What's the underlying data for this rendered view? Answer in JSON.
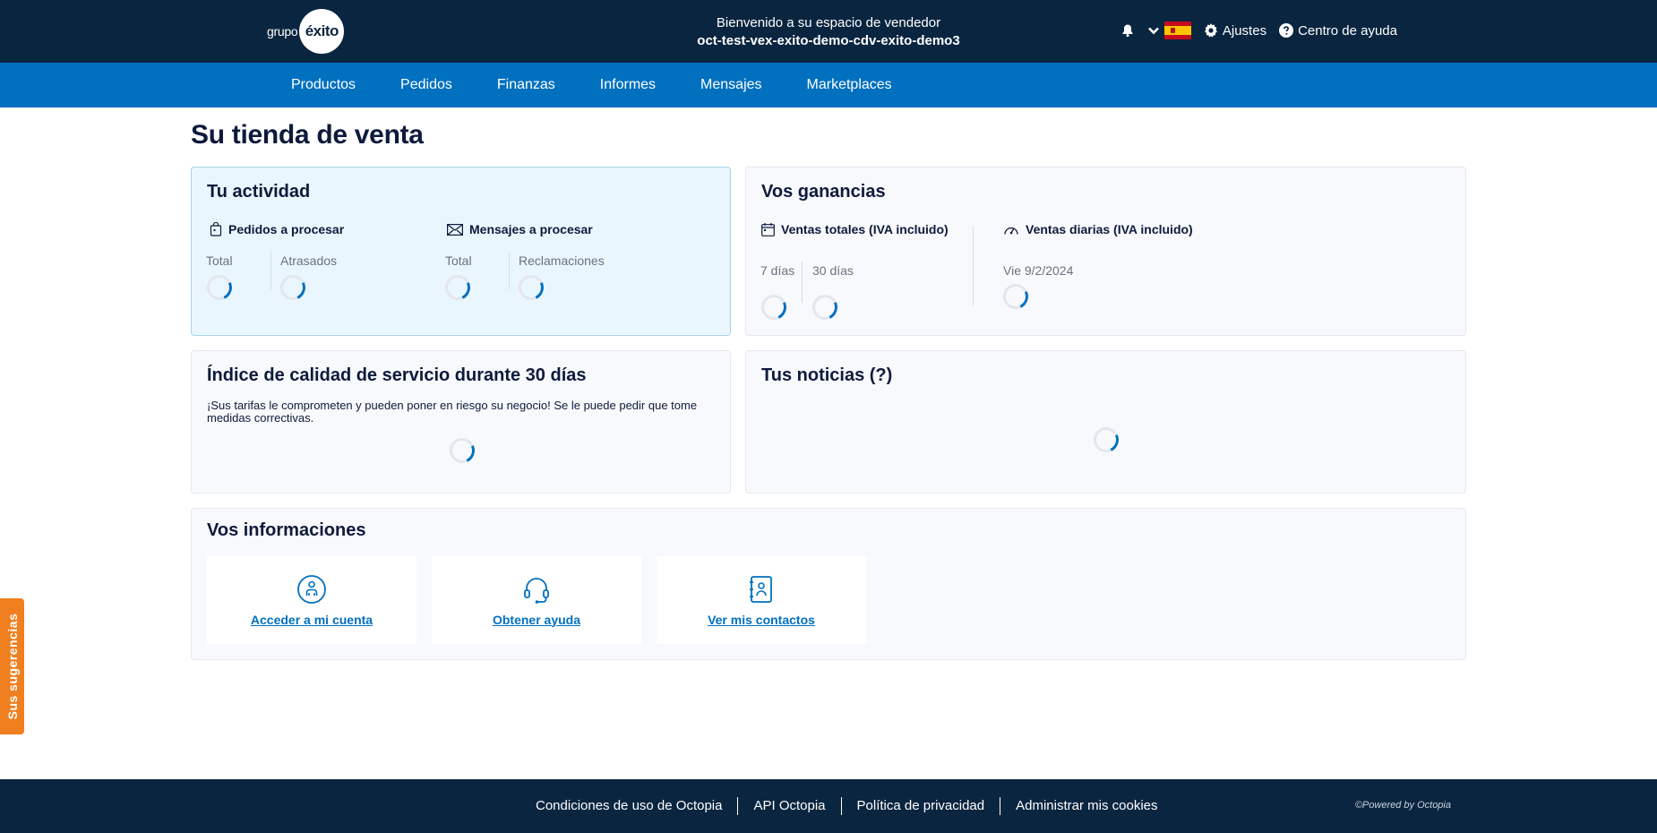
{
  "header": {
    "logo_prefix": "grupo",
    "logo_name": "éxito",
    "welcome": "Bienvenido a su espacio de vendedor",
    "store_id": "oct-test-vex-exito-demo-cdv-exito-demo3",
    "settings_label": "Ajustes",
    "help_label": "Centro de ayuda"
  },
  "nav": {
    "items": [
      "Productos",
      "Pedidos",
      "Finanzas",
      "Informes",
      "Mensajes",
      "Marketplaces"
    ]
  },
  "page": {
    "title": "Su tienda de venta"
  },
  "activity": {
    "title": "Tu actividad",
    "orders_label": "Pedidos a procesar",
    "messages_label": "Mensajes a procesar",
    "orders_total": "Total",
    "orders_late": "Atrasados",
    "messages_total": "Total",
    "messages_claims": "Reclamaciones"
  },
  "earnings": {
    "title": "Vos ganancias",
    "total_sales_label": "Ventas totales (IVA incluido)",
    "daily_sales_label": "Ventas diarias (IVA incluido)",
    "period_7": "7 días",
    "period_30": "30 días",
    "daily_date": "Vie 9/2/2024"
  },
  "quality": {
    "title": "Índice de calidad de servicio durante 30 días",
    "text": "¡Sus tarifas le comprometen y pueden poner en riesgo su negocio! Se le puede pedir que tome medidas correctivas."
  },
  "news": {
    "title": "Tus noticias (?)"
  },
  "info": {
    "title": "Vos informaciones",
    "account_link": "Acceder a mi cuenta",
    "help_link": "Obtener ayuda",
    "contacts_link": "Ver mis contactos"
  },
  "feedback": {
    "label": "Sus sugerencias"
  },
  "footer": {
    "links": [
      "Condiciones de uso de Octopia",
      "API Octopia",
      "Política de privacidad",
      "Administrar mis cookies"
    ],
    "powered": "©Powered by Octopia"
  },
  "colors": {
    "header_bg": "#0a2540",
    "nav_bg": "#0070bf",
    "accent": "#0070bf",
    "feedback_bg": "#f07f20"
  }
}
